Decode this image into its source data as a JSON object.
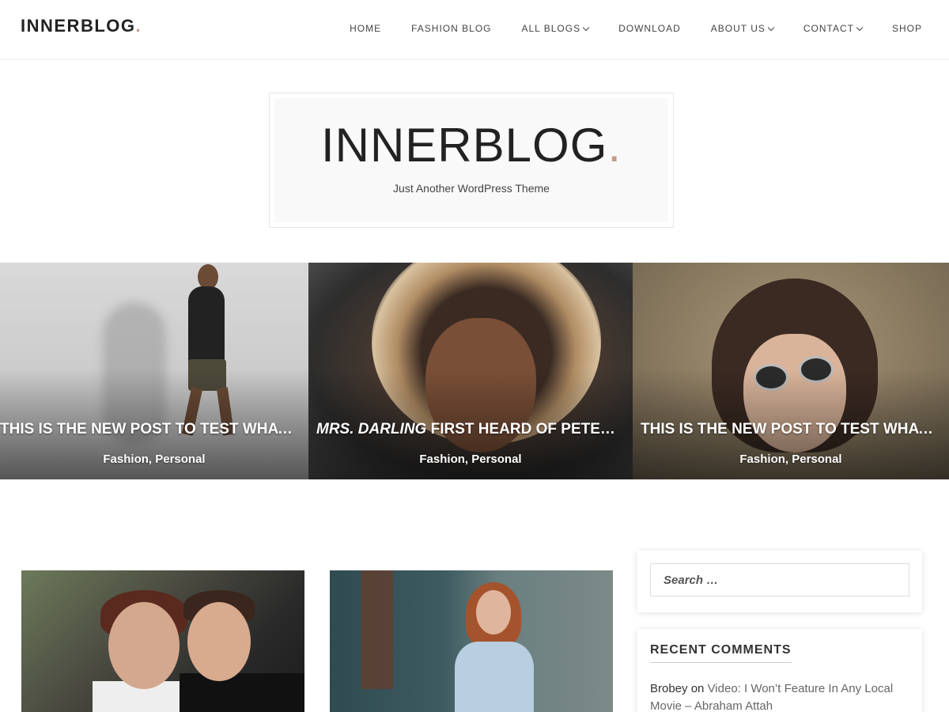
{
  "header": {
    "brand": "INNERBLOG",
    "brand_dot": ".",
    "nav": [
      {
        "label": "HOME",
        "has_dropdown": false
      },
      {
        "label": "FASHION BLOG",
        "has_dropdown": false
      },
      {
        "label": "ALL BLOGS",
        "has_dropdown": true
      },
      {
        "label": "DOWNLOAD",
        "has_dropdown": false
      },
      {
        "label": "ABOUT US",
        "has_dropdown": true
      },
      {
        "label": "CONTACT",
        "has_dropdown": true
      },
      {
        "label": "SHOP",
        "has_dropdown": false
      }
    ]
  },
  "logo": {
    "title": "INNERBLOG",
    "dot": ".",
    "tagline": "Just Another WordPress Theme"
  },
  "slider": [
    {
      "title": "THIS IS THE NEW POST TO TEST WHAT IS THE TITLE",
      "categories": "Fashion, Personal"
    },
    {
      "title_italic": "MRS. DARLING",
      "title": " FIRST HEARD OF PETER W",
      "categories": "Fashion, Personal"
    },
    {
      "title": "THIS IS THE NEW POST TO TEST WHAT HAPPENS",
      "categories": "Fashion, Personal"
    }
  ],
  "sidebar": {
    "search": {
      "placeholder": "Search …"
    },
    "recent_comments": {
      "title": "RECENT COMMENTS",
      "items": [
        {
          "author": "Brobey",
          "on": " on ",
          "post": "Video: I Won’t Feature In Any Local Movie – Abraham Attah"
        }
      ]
    }
  },
  "colors": {
    "accent_dot": "#c59d86",
    "text": "#333333"
  }
}
